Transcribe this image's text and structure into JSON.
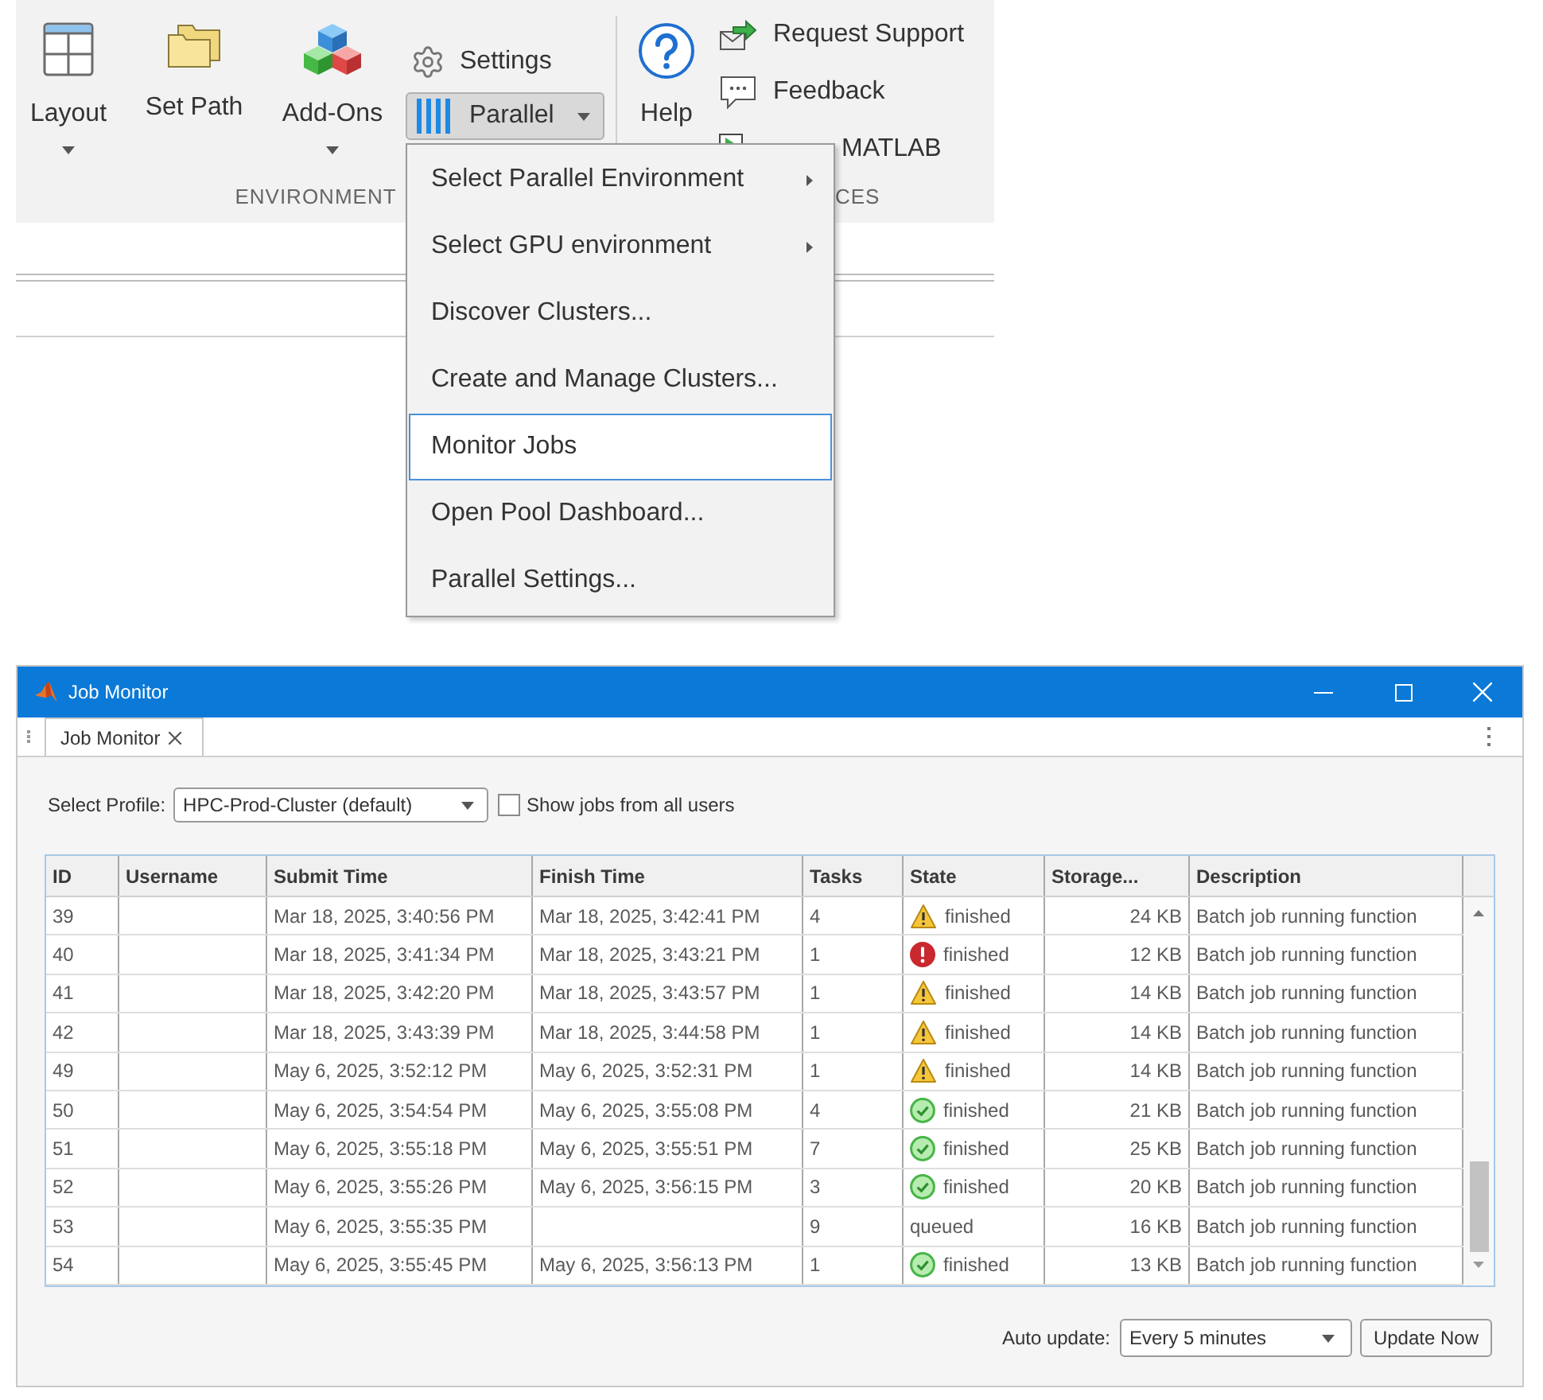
{
  "toolstrip": {
    "environment": {
      "label": "ENVIRONMENT",
      "buttons": [
        {
          "label": "Layout",
          "dropdown": true
        },
        {
          "label": "Set Path",
          "dropdown": false
        },
        {
          "label": "Add-Ons",
          "dropdown": true
        }
      ],
      "settings": {
        "label": "Settings"
      },
      "parallel": {
        "label": "Parallel",
        "expanded": true
      }
    },
    "resources": {
      "label": "CES",
      "help": {
        "label": "Help"
      },
      "links": [
        {
          "label": "Request Support"
        },
        {
          "label": "Feedback"
        },
        {
          "label": "MATLAB"
        }
      ]
    }
  },
  "parallel_menu": {
    "items": [
      {
        "label": "Select Parallel Environment",
        "submenu": true,
        "selected": false
      },
      {
        "label": "Select GPU environment",
        "submenu": true,
        "selected": false
      },
      {
        "label": "Discover Clusters...",
        "submenu": false,
        "selected": false
      },
      {
        "label": "Create and Manage Clusters...",
        "submenu": false,
        "selected": false
      },
      {
        "label": "Monitor Jobs",
        "submenu": false,
        "selected": true
      },
      {
        "label": "Open Pool Dashboard...",
        "submenu": false,
        "selected": false
      },
      {
        "label": "Parallel Settings...",
        "submenu": false,
        "selected": false
      }
    ]
  },
  "job_monitor": {
    "title": "Job Monitor",
    "tabs": [
      {
        "label": "Job Monitor",
        "selected": true
      }
    ],
    "profile": {
      "label": "Select Profile:",
      "value": "HPC-Prod-Cluster (default)"
    },
    "all_users": {
      "label": "Show jobs from all users",
      "checked": false
    },
    "table": {
      "columns": [
        "ID",
        "Username",
        "Submit Time",
        "Finish Time",
        "Tasks",
        "State",
        "Storage...",
        "Description"
      ],
      "rows": [
        {
          "kind": "warning",
          "id": "39",
          "submit_time": "Mar 18, 2025, 3:40:56 PM",
          "finish_time": "Mar 18, 2025, 3:42:41 PM",
          "tasks": "4",
          "state": "finished",
          "storage": "24 KB",
          "description": "Batch job running function"
        },
        {
          "kind": "error",
          "id": "40",
          "submit_time": "Mar 18, 2025, 3:41:34 PM",
          "finish_time": "Mar 18, 2025, 3:43:21 PM",
          "tasks": "1",
          "state": "finished",
          "storage": "12 KB",
          "description": "Batch job running function"
        },
        {
          "kind": "warning",
          "id": "41",
          "submit_time": "Mar 18, 2025, 3:42:20 PM",
          "finish_time": "Mar 18, 2025, 3:43:57 PM",
          "tasks": "1",
          "state": "finished",
          "storage": "14 KB",
          "description": "Batch job running function"
        },
        {
          "kind": "warning",
          "id": "42",
          "submit_time": "Mar 18, 2025, 3:43:39 PM",
          "finish_time": "Mar 18, 2025, 3:44:58 PM",
          "tasks": "1",
          "state": "finished",
          "storage": "14 KB",
          "description": "Batch job running function"
        },
        {
          "kind": "warning",
          "id": "49",
          "submit_time": "May 6, 2025, 3:52:12 PM",
          "finish_time": "May 6, 2025, 3:52:31 PM",
          "tasks": "1",
          "state": "finished",
          "storage": "14 KB",
          "description": "Batch job running function"
        },
        {
          "kind": "success",
          "id": "50",
          "submit_time": "May 6, 2025, 3:54:54 PM",
          "finish_time": "May 6, 2025, 3:55:08 PM",
          "tasks": "4",
          "state": "finished",
          "storage": "21 KB",
          "description": "Batch job running function"
        },
        {
          "kind": "success",
          "id": "51",
          "submit_time": "May 6, 2025, 3:55:18 PM",
          "finish_time": "May 6, 2025, 3:55:51 PM",
          "tasks": "7",
          "state": "finished",
          "storage": "25 KB",
          "description": "Batch job running function"
        },
        {
          "kind": "success",
          "id": "52",
          "submit_time": "May 6, 2025, 3:55:26 PM",
          "finish_time": "May 6, 2025, 3:56:15 PM",
          "tasks": "3",
          "state": "finished",
          "storage": "20 KB",
          "description": "Batch job running function"
        },
        {
          "kind": "queued",
          "id": "53",
          "submit_time": "May 6, 2025, 3:55:35 PM",
          "tasks": "9",
          "state": "queued",
          "storage": "16 KB",
          "description": "Batch job running function"
        },
        {
          "kind": "success",
          "id": "54",
          "submit_time": "May 6, 2025, 3:55:45 PM",
          "finish_time": "May 6, 2025, 3:56:13 PM",
          "tasks": "1",
          "state": "finished",
          "storage": "13 KB",
          "description": "Batch job running function"
        }
      ]
    },
    "auto_update": {
      "label": "Auto update:",
      "value": "Every 5 minutes"
    },
    "update_button": {
      "label": "Update Now"
    }
  }
}
